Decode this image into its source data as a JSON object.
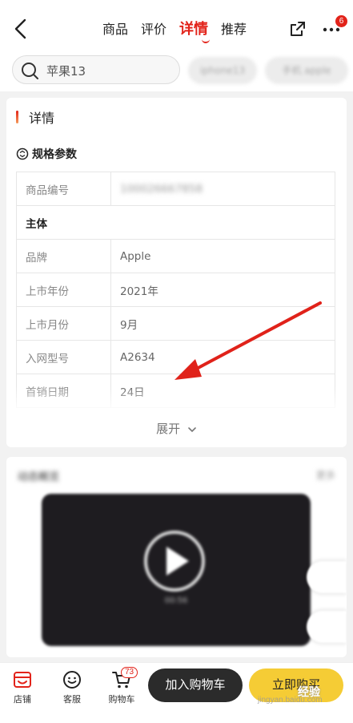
{
  "header": {
    "tabs": [
      {
        "label": "商品",
        "active": false
      },
      {
        "label": "评价",
        "active": false
      },
      {
        "label": "详情",
        "active": true
      },
      {
        "label": "推荐",
        "active": false
      }
    ],
    "notification_count": "6",
    "icons": {
      "back": "chevron-left-icon",
      "share": "share-icon",
      "more": "more-icon"
    }
  },
  "search": {
    "value": "苹果13",
    "chips": [
      "iphone13",
      "手机 apple"
    ]
  },
  "detail": {
    "section_title": "详情",
    "spec_title": "规格参数",
    "rows": [
      {
        "key": "商品编号",
        "value": "100026667858",
        "blurred": true
      },
      {
        "group": "主体"
      },
      {
        "key": "品牌",
        "value": "Apple"
      },
      {
        "key": "上市年份",
        "value": "2021年"
      },
      {
        "key": "上市月份",
        "value": "9月"
      },
      {
        "key": "入网型号",
        "value": "A2634"
      },
      {
        "key": "首销日期",
        "value": "24日"
      }
    ],
    "expand_label": "展开"
  },
  "video_section": {
    "title": "动态概览",
    "more": "更多",
    "duration": "00:56"
  },
  "bottom_bar": {
    "store_label": "店铺",
    "service_label": "客服",
    "cart_label": "购物车",
    "cart_count": "73",
    "add_to_cart_label": "加入购物车",
    "buy_now_label": "立即购买"
  },
  "watermark": {
    "text": "jingyan.baidu.com",
    "logo": "经验"
  },
  "colors": {
    "accent": "#e2231a",
    "buy": "#f5cc35",
    "cart_button": "#2b2b2b"
  }
}
